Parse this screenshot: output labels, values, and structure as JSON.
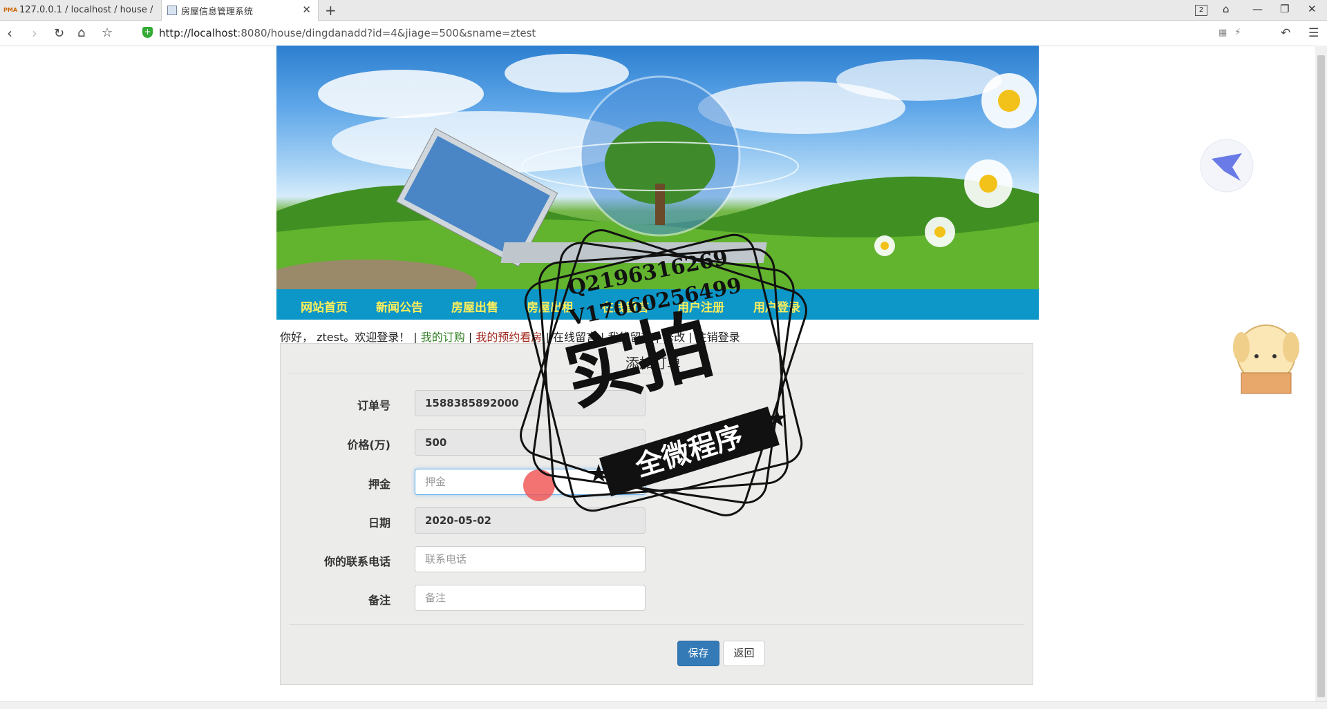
{
  "browser": {
    "tabs": [
      {
        "label": "127.0.0.1 / localhost / house /",
        "favicon": "PMA"
      },
      {
        "label": "房屋信息管理系统",
        "favicon": "page-icon"
      }
    ],
    "window_count": "2",
    "url_host": "http://localhost",
    "url_rest": ":8080/house/dingdanadd?id=4&jiage=500&sname=ztest"
  },
  "site": {
    "nav": [
      "网站首页",
      "新闻公告",
      "房屋出售",
      "房屋出租",
      "在线留言",
      "用户注册",
      "用户登录"
    ],
    "welcome": {
      "greeting": "你好， ztest。欢迎登录！",
      "sep": " | ",
      "my_orders": "我的订购",
      "my_viewings": "我的预约看房",
      "message": "在线留言",
      "my_messages": "我的留言",
      "edit": "修改",
      "logout": "注销登录"
    }
  },
  "form": {
    "title": "添加订单",
    "fields": [
      {
        "label": "订单号",
        "value": "1588385892000",
        "placeholder": "",
        "readonly": true
      },
      {
        "label": "价格(万)",
        "value": "500",
        "placeholder": "",
        "readonly": true
      },
      {
        "label": "押金",
        "value": "",
        "placeholder": "押金",
        "readonly": false
      },
      {
        "label": "日期",
        "value": "2020-05-02",
        "placeholder": "",
        "readonly": true
      },
      {
        "label": "你的联系电话",
        "value": "",
        "placeholder": "联系电话",
        "readonly": false
      },
      {
        "label": "备注",
        "value": "",
        "placeholder": "备注",
        "readonly": false
      }
    ],
    "save_label": "保存",
    "back_label": "返回"
  },
  "watermark": {
    "main": "实拍",
    "band": "全微程序",
    "line1": "Q2196316269",
    "line2": "V17060256499"
  },
  "colors": {
    "nav_bg": "#0d96c8",
    "nav_text": "#ffef5a",
    "primary": "#337ab7"
  }
}
